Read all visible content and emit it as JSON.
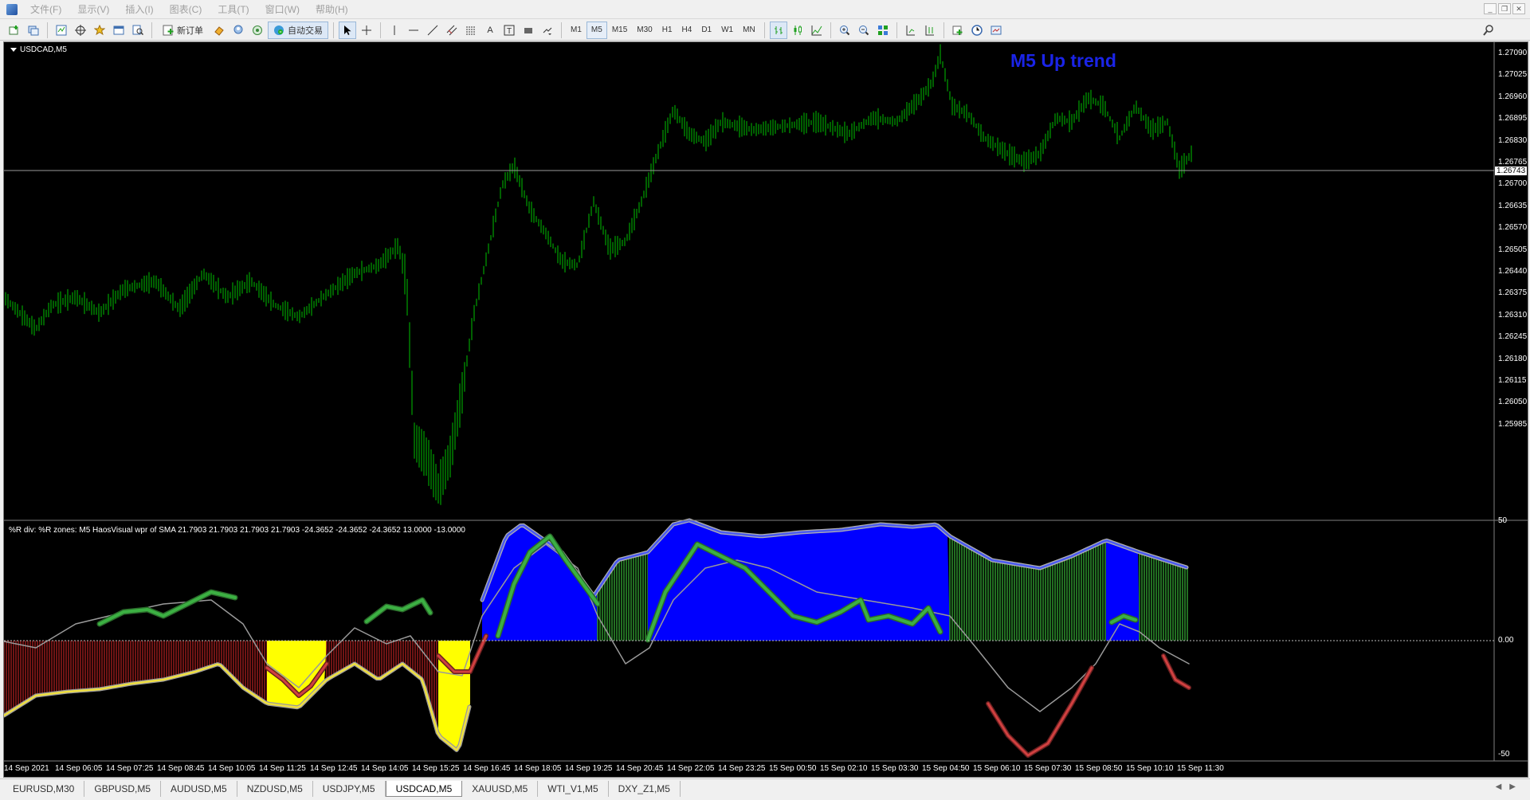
{
  "menu": {
    "items": [
      "文件(F)",
      "显示(V)",
      "插入(I)",
      "图表(C)",
      "工具(T)",
      "窗口(W)",
      "帮助(H)"
    ]
  },
  "toolbar": {
    "new_order": "新订单",
    "auto_trading": "自动交易",
    "text_tool": "A",
    "text_label_tool": "T",
    "timeframes": [
      "M1",
      "M5",
      "M15",
      "M30",
      "H1",
      "H4",
      "D1",
      "W1",
      "MN"
    ],
    "active_timeframe": "M5"
  },
  "chart": {
    "label": "USDCAD,M5",
    "trend_text": "M5 Up trend",
    "current_price": "1.26743",
    "price_ticks": [
      "1.27090",
      "1.27025",
      "1.26960",
      "1.26895",
      "1.26830",
      "1.26765",
      "1.26700",
      "1.26635",
      "1.26570",
      "1.26505",
      "1.26440",
      "1.26375",
      "1.26310",
      "1.26245",
      "1.26180",
      "1.26115",
      "1.26050",
      "1.25985"
    ],
    "indicator_label": "%R div: %R zones: M5 HaosVisual wpr of SMA 21.7903 21.7903 21.7903 21.7903 -24.3652 -24.3652 -24.3652 13.0000 -13.0000",
    "indicator_ticks": [
      "50",
      "0.00",
      "-50"
    ],
    "time_ticks": [
      "14 Sep 2021",
      "14 Sep 06:05",
      "14 Sep 07:25",
      "14 Sep 08:45",
      "14 Sep 10:05",
      "14 Sep 11:25",
      "14 Sep 12:45",
      "14 Sep 14:05",
      "14 Sep 15:25",
      "14 Sep 16:45",
      "14 Sep 18:05",
      "14 Sep 19:25",
      "14 Sep 20:45",
      "14 Sep 22:05",
      "14 Sep 23:25",
      "15 Sep 00:50",
      "15 Sep 02:10",
      "15 Sep 03:30",
      "15 Sep 04:50",
      "15 Sep 06:10",
      "15 Sep 07:30",
      "15 Sep 08:50",
      "15 Sep 10:10",
      "15 Sep 11:30"
    ],
    "colors": {
      "background": "#000000",
      "bars": "#00c000",
      "trend_text": "#1a24e8",
      "zone_blue": "#0000ff",
      "zone_yellow": "#ffff00",
      "zone_red": "#8b1a1a",
      "zone_green": "#2a8a2a",
      "line_green": "#3cb043",
      "line_red": "#d04040"
    }
  },
  "tabs": {
    "items": [
      "EURUSD,M30",
      "GBPUSD,M5",
      "AUDUSD,M5",
      "NZDUSD,M5",
      "USDJPY,M5",
      "USDCAD,M5",
      "XAUUSD,M5",
      "WTI_V1,M5",
      "DXY_Z1,M5"
    ],
    "active": "USDCAD,M5"
  }
}
